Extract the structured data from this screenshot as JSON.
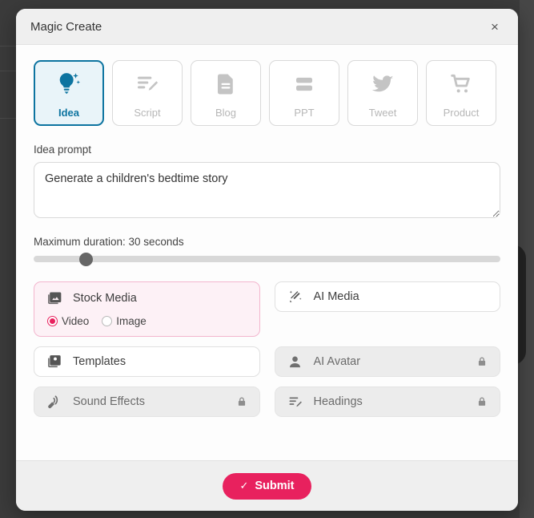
{
  "modal": {
    "title": "Magic Create",
    "close_label": "×"
  },
  "tabs": [
    {
      "label": "Idea",
      "icon": "lightbulb-sparkle-icon",
      "selected": true
    },
    {
      "label": "Script",
      "icon": "script-edit-icon",
      "selected": false
    },
    {
      "label": "Blog",
      "icon": "document-icon",
      "selected": false
    },
    {
      "label": "PPT",
      "icon": "slides-icon",
      "selected": false
    },
    {
      "label": "Tweet",
      "icon": "twitter-bird-icon",
      "selected": false
    },
    {
      "label": "Product",
      "icon": "shopping-cart-icon",
      "selected": false
    }
  ],
  "prompt": {
    "label": "Idea prompt",
    "value": "Generate a children's bedtime story",
    "placeholder": "Generate a children's bedtime story"
  },
  "duration": {
    "label": "Maximum duration: 30 seconds",
    "value": "30",
    "min": "0",
    "max": "300"
  },
  "options": {
    "stock_media": {
      "label": "Stock Media",
      "icon": "image-stack-icon",
      "radios": [
        {
          "label": "Video",
          "checked": true
        },
        {
          "label": "Image",
          "checked": false
        }
      ]
    },
    "ai_media": {
      "label": "AI Media",
      "icon": "magic-wand-icon",
      "locked": false
    },
    "templates": {
      "label": "Templates",
      "icon": "templates-icon",
      "locked": false
    },
    "ai_avatar": {
      "label": "AI Avatar",
      "icon": "person-icon",
      "locked": true
    },
    "sound_effects": {
      "label": "Sound Effects",
      "icon": "sound-wave-icon",
      "locked": true
    },
    "headings": {
      "label": "Headings",
      "icon": "headings-edit-icon",
      "locked": true
    }
  },
  "footer": {
    "submit_label": "Submit",
    "submit_check": "✓"
  },
  "colors": {
    "accent_pink": "#e8215e",
    "accent_blue": "#0d74a0",
    "card_pink_bg": "#fdf1f6",
    "card_pink_border": "#f3b6ce",
    "locked_bg": "#ececec",
    "header_bg": "#efefef",
    "backdrop": "#3b3b3b"
  }
}
